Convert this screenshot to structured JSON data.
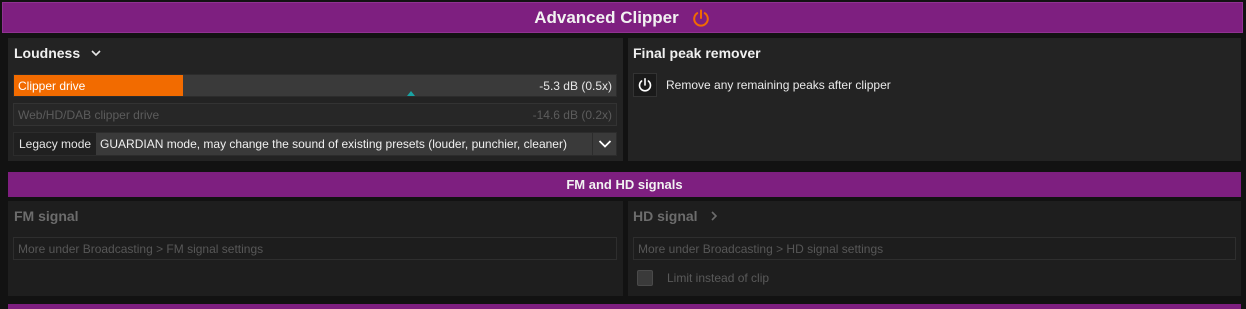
{
  "header": {
    "title": "Advanced Clipper",
    "power_icon": "power-icon",
    "accent": "#7e1f80",
    "icon_color": "#f26b00"
  },
  "loudness": {
    "title": "Loudness",
    "clipper_drive": {
      "label": "Clipper drive",
      "value": "-5.3 dB (0.5x)",
      "fill_fraction": 0.28,
      "marker_fraction": 0.66
    },
    "web_clipper_drive": {
      "label": "Web/HD/DAB clipper drive",
      "value": "-14.6 dB (0.2x)"
    },
    "legacy_mode": {
      "label": "Legacy mode",
      "value": "GUARDIAN mode, may change the sound of existing presets (louder, punchier, cleaner)"
    }
  },
  "final_peak": {
    "title": "Final peak remover",
    "toggle_label": "Remove any remaining peaks after clipper"
  },
  "fm_hd_section": {
    "title": "FM and HD signals"
  },
  "fm_signal": {
    "title": "FM signal",
    "info": "More under Broadcasting > FM signal settings"
  },
  "hd_signal": {
    "title": "HD signal",
    "info": "More under Broadcasting > HD signal settings",
    "checkbox_label": "Limit instead of clip"
  }
}
